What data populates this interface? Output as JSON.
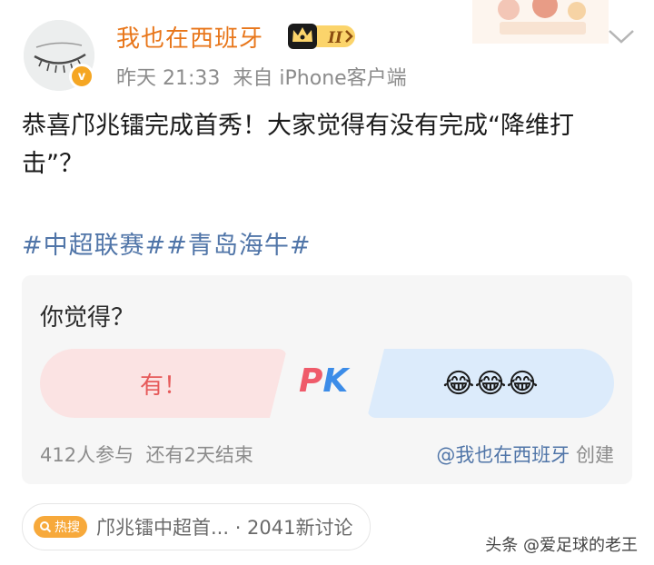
{
  "post": {
    "username": "我也在西班牙",
    "vip_level": "II",
    "verified_badge": "v",
    "time": "昨天 21:33",
    "source_prefix": "来自",
    "source": "iPhone客户端",
    "content": "恭喜邝兆镭完成首秀！大家觉得有没有完成“降维打击”？",
    "hashtags": "#中超联赛##青岛海牛#"
  },
  "vote": {
    "question": "你觉得？",
    "option_left": "有！",
    "pk_p": "P",
    "pk_k": "K",
    "option_right": "😂😂😂",
    "participants": "412人参与",
    "remaining": "还有2天结束",
    "creator": "@我也在西班牙",
    "creator_suffix": "创建"
  },
  "hot_search": {
    "badge": "热搜",
    "text": "邝兆镭中超首... · 2041新讨论"
  },
  "watermark": "头条 @爱足球的老王",
  "icons": [
    "chevron-down-icon",
    "crown-icon",
    "search-icon",
    "avatar-closed-eye"
  ],
  "colors": {
    "username": "#e8761a",
    "link": "#5075a8",
    "accent": "#f5a623"
  }
}
